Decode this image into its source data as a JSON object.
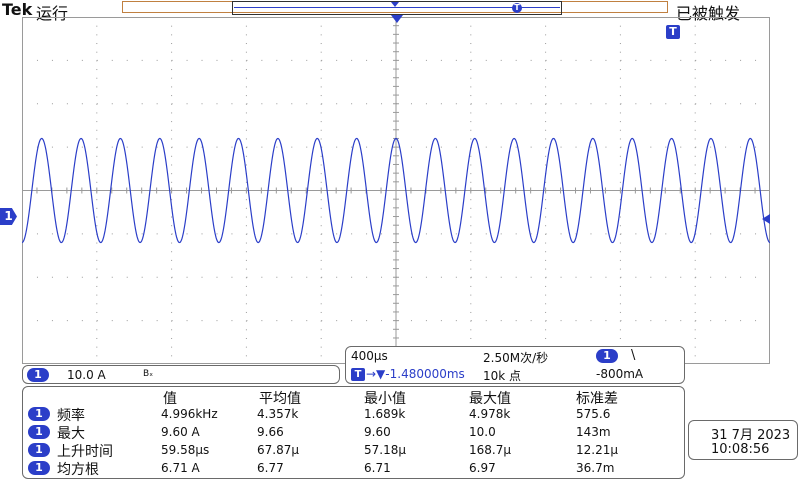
{
  "top": {
    "brand": "Tek",
    "run_state": "运行",
    "trigger_state": "已被触发",
    "trigger_marker": "T"
  },
  "channel": {
    "number": "1",
    "scale": "10.0 A",
    "bw_label": "Bₓ"
  },
  "horizontal": {
    "time_per_div": "400µs",
    "sample_rate": "2.50M次/秒",
    "trigger_icon": "T",
    "trigger_position": "→▼-1.480000ms",
    "record_length": "10k 点",
    "trigger_source": "1",
    "trigger_slope": "\\",
    "trigger_level": "-800mA"
  },
  "measurements": {
    "headers": [
      "值",
      "平均值",
      "最小值",
      "最大值",
      "标准差"
    ],
    "rows": [
      {
        "ch": "1",
        "name": "频率",
        "values": [
          "4.996kHz",
          "4.357k",
          "1.689k",
          "4.978k",
          "575.6"
        ]
      },
      {
        "ch": "1",
        "name": "最大",
        "values": [
          "9.60 A",
          "9.66",
          "9.60",
          "10.0",
          "143m"
        ]
      },
      {
        "ch": "1",
        "name": "上升时间",
        "values": [
          "59.58µs",
          "67.87µ",
          "57.18µ",
          "168.7µ",
          "12.21µ"
        ]
      },
      {
        "ch": "1",
        "name": "均方根",
        "values": [
          "6.71 A",
          "6.77",
          "6.71",
          "6.97",
          "36.7m"
        ]
      }
    ]
  },
  "clock": {
    "date": "31 7月 2023",
    "time": "10:08:56"
  },
  "waveform": {
    "cycles_on_screen": 19,
    "amplitude_fraction_of_div": 1.2,
    "color": "#2b3ec8"
  },
  "colors": {
    "trace": "#2b3ec8",
    "grid": "#9a9a9a",
    "record_bar": "#c08040"
  }
}
